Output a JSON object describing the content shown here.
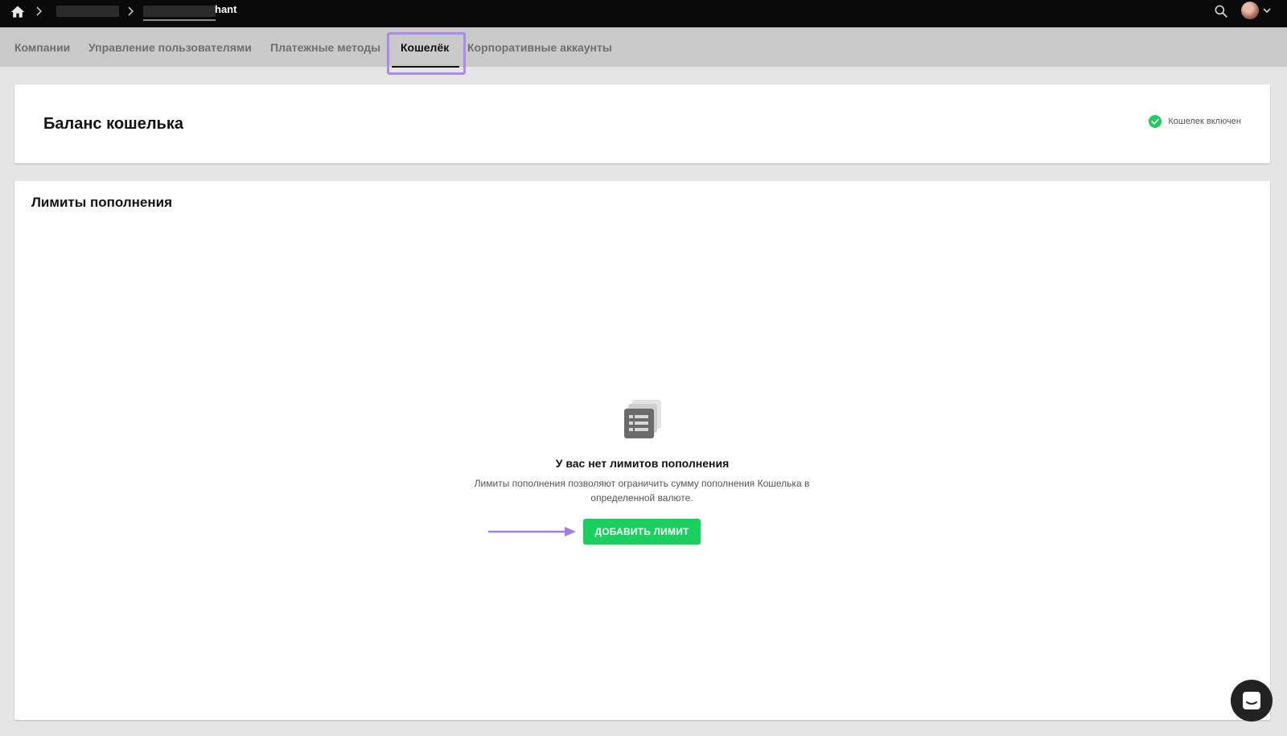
{
  "topbar": {
    "breadcrumb_current": "hant",
    "icons": [
      "home-icon",
      "chevron-right-icon",
      "search-icon",
      "avatar",
      "chevron-down-icon"
    ]
  },
  "tabs": [
    {
      "label": "Компании",
      "active": false
    },
    {
      "label": "Управление пользователями",
      "active": false
    },
    {
      "label": "Платежные методы",
      "active": false
    },
    {
      "label": "Кошелёк",
      "active": true
    },
    {
      "label": "Корпоративные аккаунты",
      "active": false
    }
  ],
  "balance": {
    "title": "Баланс кошелька",
    "status_text": "Кошелек включен",
    "status_color": "#1ecb5c"
  },
  "limits": {
    "title": "Лимиты пополнения",
    "empty_title": "У вас нет лимитов пополнения",
    "empty_description": "Лимиты пополнения позволяют ограничить сумму пополнения Кошелька в определенной валюте.",
    "add_button_label": "ДОБАВИТЬ ЛИМИТ"
  },
  "colors": {
    "accent_green": "#19cf5f",
    "highlight_purple": "#a98ee8",
    "topbar": "#0a0a0a",
    "tabbar": "#c9c9c9"
  }
}
